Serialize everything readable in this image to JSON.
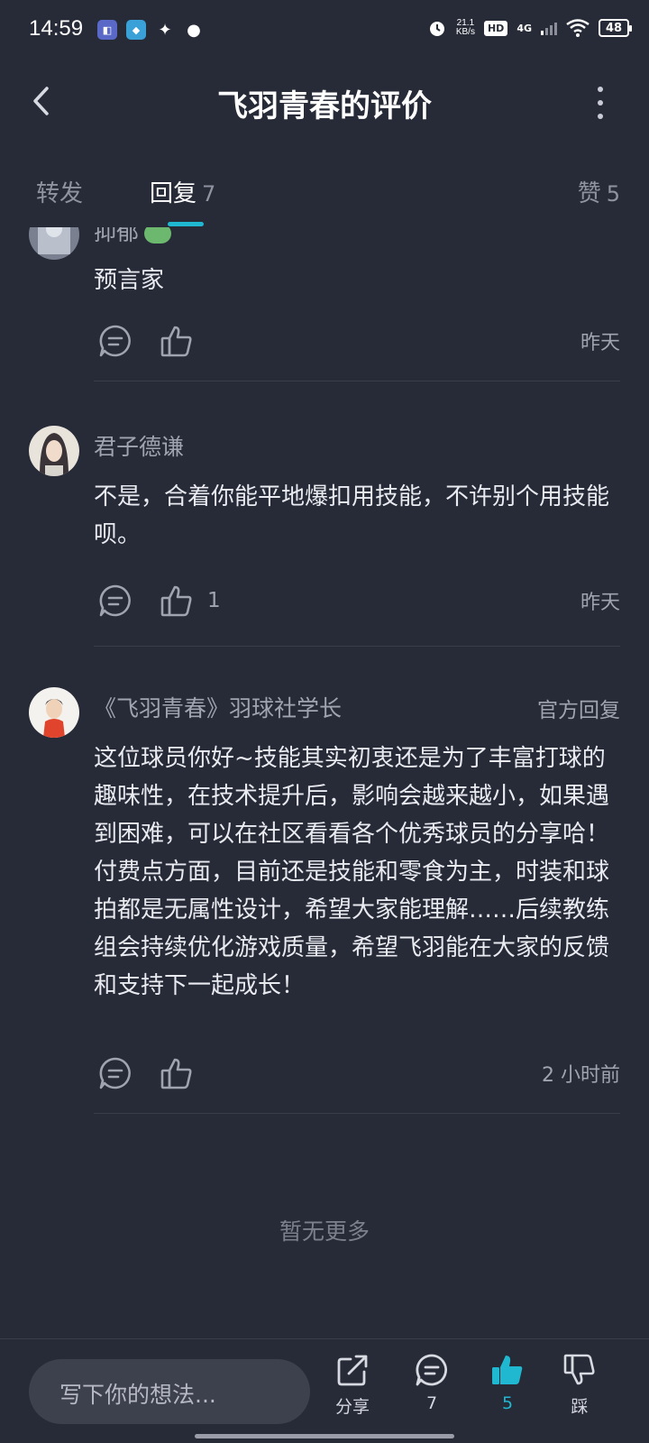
{
  "status_bar": {
    "time": "14:59",
    "net_speed_value": "21.1",
    "net_speed_unit": "KB/s",
    "hd": "HD",
    "signal": "4G",
    "battery": "48",
    "notif_icons": [
      "app-badge-icon",
      "game-app-icon",
      "tt-app-icon",
      "wechat-icon"
    ]
  },
  "header": {
    "title": "飞羽青春的评价"
  },
  "tabs": [
    {
      "label": "转发",
      "count": ""
    },
    {
      "label": "回复",
      "count": "7"
    },
    {
      "label": "赞",
      "count": "5"
    }
  ],
  "active_tab": "回复",
  "comments": [
    {
      "author": "抑郁",
      "text": "预言家",
      "likes": "",
      "time": "昨天",
      "official": ""
    },
    {
      "author": "君子德谦",
      "text": "不是，合着你能平地爆扣用技能，不许别个用技能呗。",
      "likes": "1",
      "time": "昨天",
      "official": ""
    },
    {
      "author": "《飞羽青春》羽球社学长",
      "text": "这位球员你好~技能其实初衷还是为了丰富打球的趣味性，在技术提升后，影响会越来越小，如果遇到困难，可以在社区看看各个优秀球员的分享哈！付费点方面，目前还是技能和零食为主，时装和球拍都是无属性设计，希望大家能理解……后续教练组会持续优化游戏质量，希望飞羽能在大家的反馈和支持下一起成长！",
      "likes": "",
      "time": "2 小时前",
      "official": "官方回复"
    }
  ],
  "no_more": "暂无更多",
  "bottom_bar": {
    "input_placeholder": "写下你的想法...",
    "share_label": "分享",
    "reply_count": "7",
    "like_count": "5",
    "dislike_label": "踩"
  },
  "colors": {
    "background": "#272a37",
    "accent": "#1fb8d0",
    "secondary_text": "#a0a4b0"
  }
}
